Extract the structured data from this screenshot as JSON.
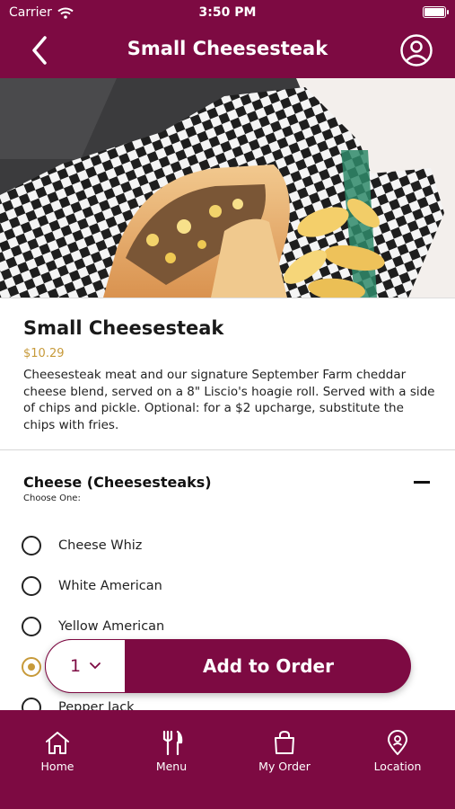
{
  "status_bar": {
    "carrier": "Carrier",
    "time": "3:50 PM"
  },
  "header": {
    "title": "Small Cheesesteak"
  },
  "item": {
    "name": "Small Cheesesteak",
    "price": "$10.29",
    "description": "Cheesesteak meat and our signature September Farm cheddar cheese blend, served on a 8\" Liscio's hoagie roll. Served with a side of chips and pickle. Optional: for a $2 upcharge, substitute the chips with fries."
  },
  "modifier_group": {
    "title": "Cheese (Cheesesteaks)",
    "subtitle": "Choose One:",
    "options": [
      {
        "label": "Cheese Whiz",
        "selected": false
      },
      {
        "label": "White American",
        "selected": false
      },
      {
        "label": "Yellow American",
        "selected": false
      },
      {
        "label": "",
        "selected": true
      },
      {
        "label": "Pepper Jack",
        "selected": false
      }
    ]
  },
  "order_bar": {
    "quantity": "1",
    "add_label": "Add to Order"
  },
  "tabs": [
    {
      "label": "Home",
      "icon": "home-icon"
    },
    {
      "label": "Menu",
      "icon": "fork-knife-icon"
    },
    {
      "label": "My Order",
      "icon": "shopping-bag-icon"
    },
    {
      "label": "Location",
      "icon": "map-pin-icon"
    }
  ],
  "colors": {
    "brand": "#7d0a42",
    "accent": "#c79a3a"
  }
}
